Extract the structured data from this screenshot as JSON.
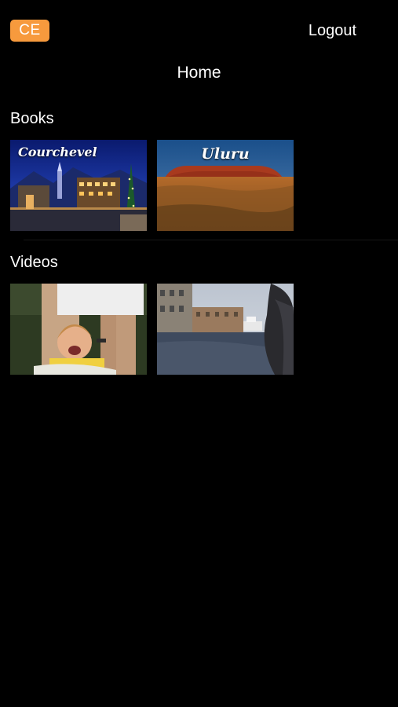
{
  "header": {
    "user_initials": "CE",
    "logout_label": "Logout",
    "title": "Home"
  },
  "sections": [
    {
      "title": "Books",
      "items": [
        {
          "label": "Courchevel",
          "icon": "book-thumbnail"
        },
        {
          "label": "Uluru",
          "icon": "book-thumbnail"
        }
      ]
    },
    {
      "title": "Videos",
      "items": [
        {
          "icon": "video-thumbnail"
        },
        {
          "icon": "video-thumbnail"
        }
      ]
    }
  ],
  "colors": {
    "background": "#000000",
    "accent": "#f79a3d",
    "text": "#ffffff"
  }
}
